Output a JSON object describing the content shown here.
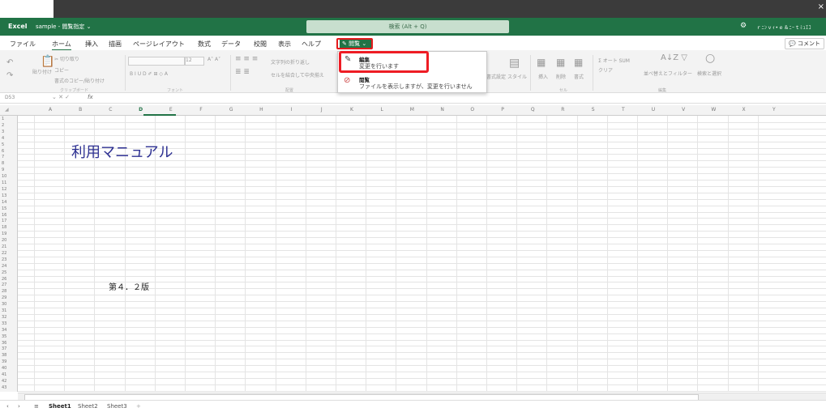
{
  "window": {
    "close_glyph": "×"
  },
  "titlebar": {
    "app_name": "Excel",
    "file_label": "sample - 閲覧指定 ⌄",
    "search_placeholder": "検索 (Alt + Q)",
    "settings_icon": "gear-icon"
  },
  "ribbon_tabs": [
    {
      "label": "ファイル"
    },
    {
      "label": "ホーム",
      "active": true
    },
    {
      "label": "挿入"
    },
    {
      "label": "描画"
    },
    {
      "label": "ページレイアウト"
    },
    {
      "label": "数式"
    },
    {
      "label": "データ"
    },
    {
      "label": "校閲"
    },
    {
      "label": "表示"
    },
    {
      "label": "ヘルプ"
    }
  ],
  "mode_button": {
    "label": "✎ 閲覧 ⌄"
  },
  "comment_button": {
    "label": "💬 コメント"
  },
  "ribbon": {
    "clipboard": {
      "cut": "✂ 切り取り",
      "paste": "貼り付け",
      "copy": "コピー",
      "format_painter": "書式のコピー/貼り付け",
      "group_label": "クリップボード"
    },
    "font": {
      "size": "12",
      "group_label": "フォント"
    },
    "alignment": {
      "wrap": "文字列の折り返し",
      "merge": "セルを結合して中央揃え",
      "group_label": "配置"
    },
    "styles": {
      "table": "書式設定",
      "cell_styles": "スタイル"
    },
    "cells": {
      "insert": "挿入",
      "delete": "削除",
      "format": "書式",
      "group_label": "セル"
    },
    "editing": {
      "autosum": "Σ オート SUM",
      "clear": "クリア",
      "sort": "並べ替えとフィルター",
      "find": "検索と選択",
      "group_label": "編集"
    }
  },
  "formula_bar": {
    "name_box": "D53",
    "fx": "fx"
  },
  "columns": [
    "A",
    "B",
    "C",
    "D",
    "E",
    "F",
    "G",
    "H",
    "I",
    "J",
    "K",
    "L",
    "M",
    "N",
    "O",
    "P",
    "Q",
    "R",
    "S",
    "T",
    "U",
    "V",
    "W",
    "X",
    "Y"
  ],
  "selected_column": "D",
  "cells": {
    "title": "利用マニュアル",
    "version": "第４．２版"
  },
  "sheets": [
    {
      "label": "Sheet1",
      "active": true
    },
    {
      "label": "Sheet2"
    },
    {
      "label": "Sheet3"
    }
  ],
  "sheet_add": "+",
  "dropdown": {
    "items": [
      {
        "title": "編集",
        "description": "変更を行います",
        "icon": "pencil-icon"
      },
      {
        "title": "閲覧",
        "description": "ファイルを表示しますが、変更を行いません",
        "icon": "view-only-icon"
      }
    ]
  },
  "colors": {
    "accent": "#217346",
    "highlight": "#ee1c24",
    "title_text": "#2e3192"
  }
}
